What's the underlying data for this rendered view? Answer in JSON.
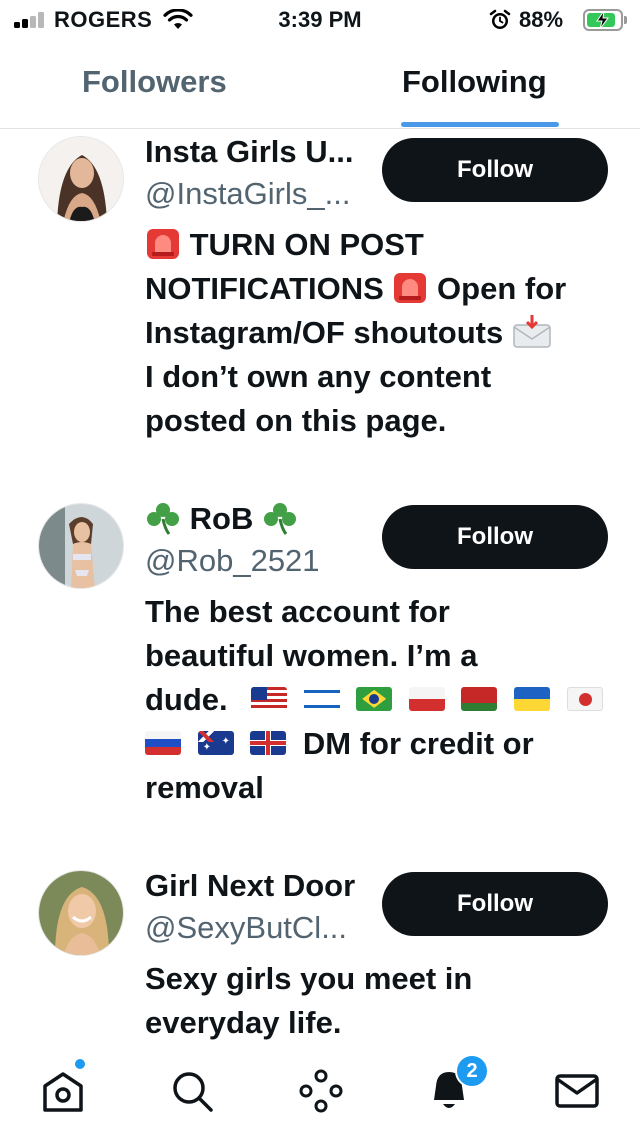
{
  "status_bar": {
    "carrier": "ROGERS",
    "time": "3:39 PM",
    "battery_percent": "88%",
    "battery_level": 0.88,
    "icons": [
      "signal-icon",
      "wifi-icon",
      "alarm-icon",
      "battery-charging-icon"
    ]
  },
  "tabs": [
    {
      "label": "Followers",
      "selected": false
    },
    {
      "label": "Following",
      "selected": true
    }
  ],
  "users": [
    {
      "name": "Insta Girls U...",
      "handle": "@InstaGirls_...",
      "follow_label": "Follow",
      "bio_lines": [
        {
          "text": "TURN ON POST",
          "emoji": "siren"
        },
        {
          "text": "NOTIFICATIONS",
          "after": "Open for"
        },
        {
          "text": "Instagram/OF shoutouts"
        },
        {
          "text": "I don’t own any content"
        },
        {
          "text": "posted on this page."
        }
      ]
    },
    {
      "name": "RoB",
      "handle": "@Rob_2521",
      "follow_label": "Follow",
      "bio_lines": [
        {
          "text": "The best account for"
        },
        {
          "text": "beautiful women. I’m a"
        },
        {
          "text": "dude."
        },
        {
          "text": "DM for credit or"
        },
        {
          "text": "removal"
        }
      ]
    },
    {
      "name": "Girl Next Door",
      "handle": "@SexyButCl...",
      "follow_label": "Follow",
      "bio_lines": [
        {
          "text": "Sexy girls you meet in"
        },
        {
          "text": "everyday life."
        }
      ]
    }
  ],
  "bottom_nav": {
    "items": [
      "home-icon",
      "search-icon",
      "spaces-icon",
      "notifications-icon",
      "messages-icon"
    ],
    "notification_count": "2",
    "accent_color": "#1d9bf0"
  }
}
